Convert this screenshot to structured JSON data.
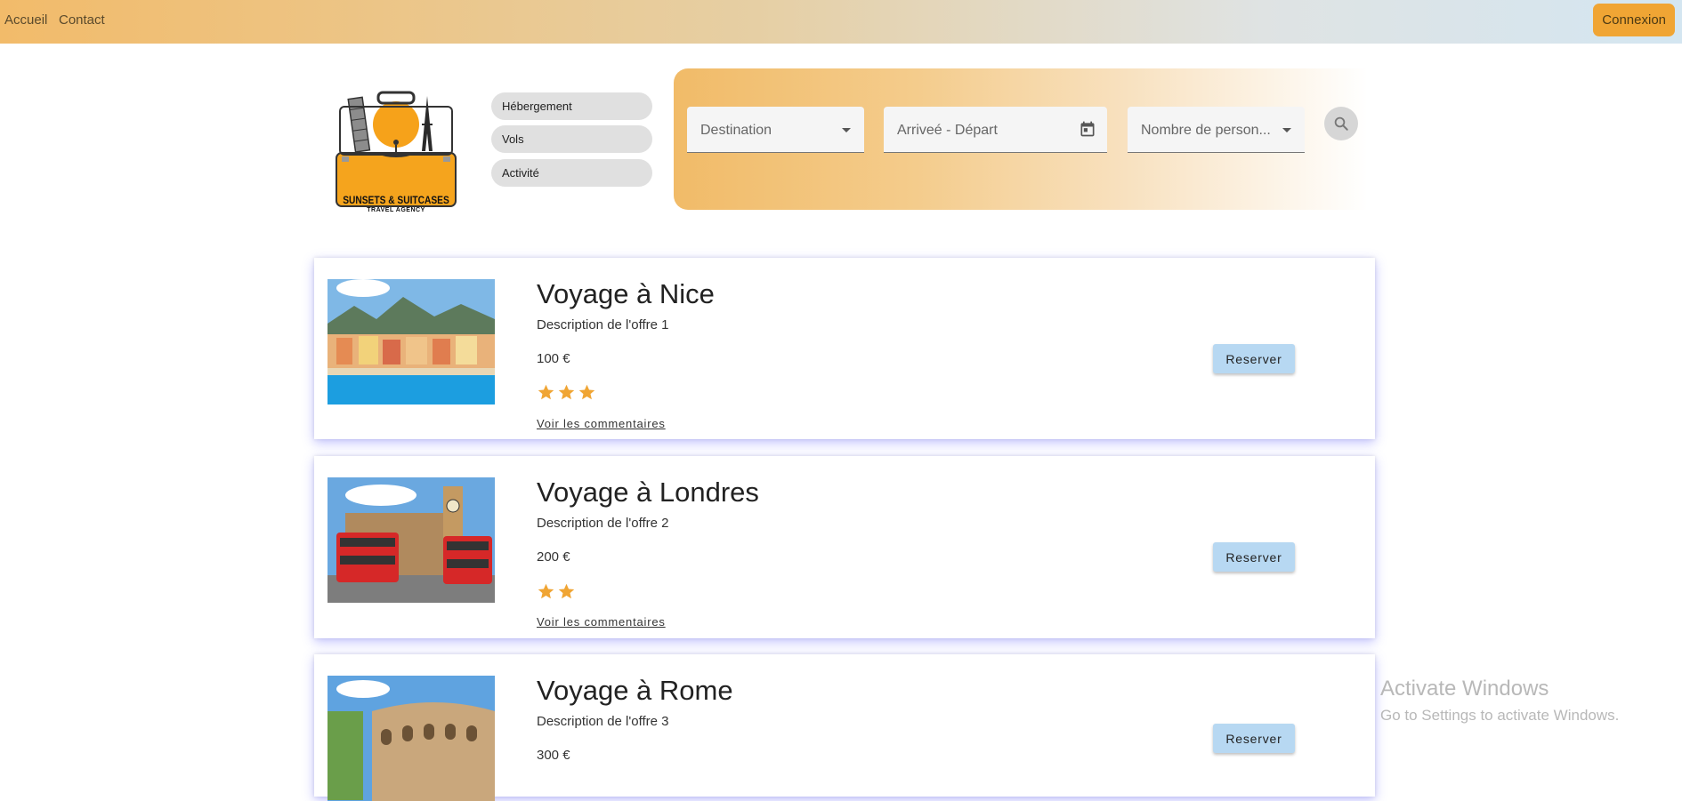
{
  "nav": {
    "home": "Accueil",
    "contact": "Contact",
    "login": "Connexion"
  },
  "logo": {
    "title": "SUNSETS & SUITCASES",
    "subtitle": "TRAVEL AGENCY"
  },
  "categories": [
    "Hébergement",
    "Vols",
    "Activité"
  ],
  "search": {
    "destination": "Destination",
    "dates": "Arriveé - Départ",
    "people": "Nombre de person..."
  },
  "offers": [
    {
      "title": "Voyage à Nice",
      "description": "Description de l'offre 1",
      "price": "100 €",
      "rating": 3,
      "comments": "Voir les commentaires",
      "reserve": "Reserver"
    },
    {
      "title": "Voyage à Londres",
      "description": "Description de l'offre 2",
      "price": "200 €",
      "rating": 2,
      "comments": "Voir les commentaires",
      "reserve": "Reserver"
    },
    {
      "title": "Voyage à Rome",
      "description": "Description de l'offre 3",
      "price": "300 €",
      "rating": 0,
      "comments": "",
      "reserve": "Reserver"
    }
  ],
  "watermark": {
    "title": "Activate Windows",
    "subtitle": "Go to Settings to activate Windows."
  },
  "colors": {
    "accent": "#f0a534",
    "star": "#f0a534",
    "reserve_button": "#b7d8f2"
  }
}
